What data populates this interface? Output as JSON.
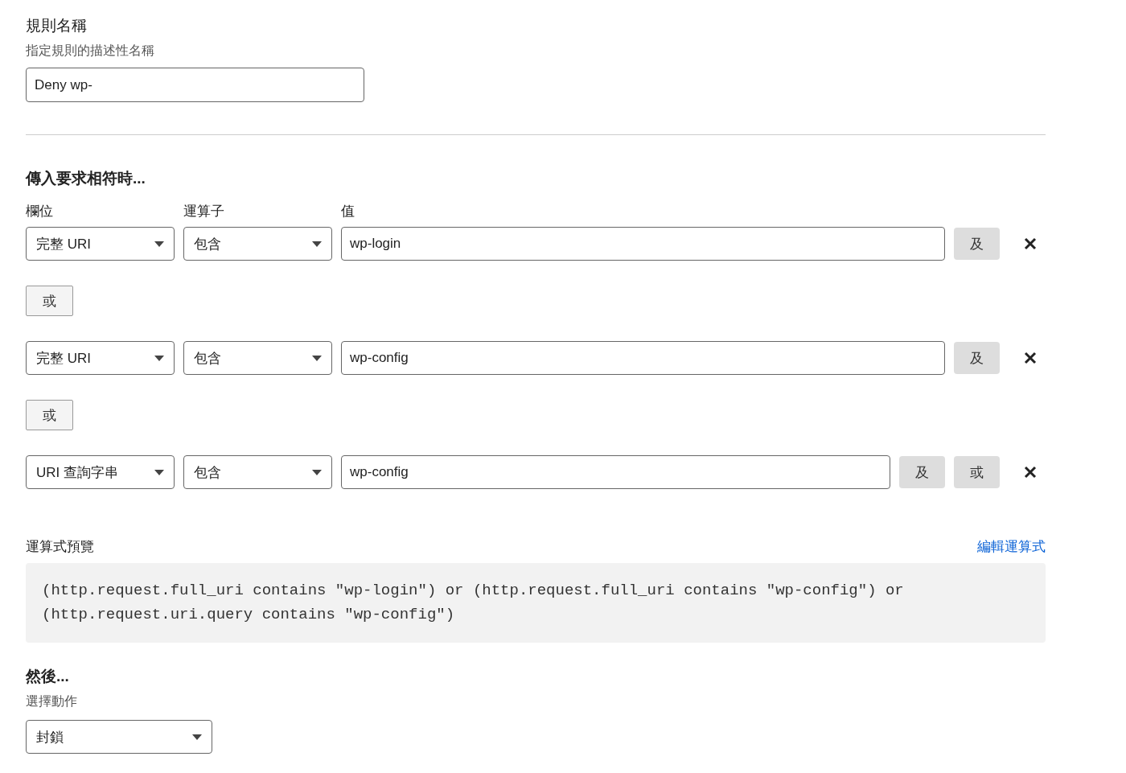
{
  "rule_name": {
    "label": "規則名稱",
    "hint": "指定規則的描述性名稱",
    "value": "Deny wp-"
  },
  "match": {
    "heading": "傳入要求相符時...",
    "columns": [
      "欄位",
      "運算子",
      "值"
    ],
    "rows": [
      {
        "kind": "condition",
        "field": "完整 URI",
        "operator": "包含",
        "value": "wp-login",
        "buttons": [
          "及"
        ]
      },
      {
        "kind": "or",
        "label": "或"
      },
      {
        "kind": "condition",
        "field": "完整 URI",
        "operator": "包含",
        "value": "wp-config",
        "buttons": [
          "及"
        ]
      },
      {
        "kind": "or",
        "label": "或"
      },
      {
        "kind": "condition",
        "field": "URI 查詢字串",
        "operator": "包含",
        "value": "wp-config",
        "buttons": [
          "及",
          "或"
        ]
      }
    ]
  },
  "preview": {
    "label": "運算式預覽",
    "edit_link": "編輯運算式",
    "expression": "(http.request.full_uri contains \"wp-login\") or (http.request.full_uri contains \"wp-config\") or (http.request.uri.query contains \"wp-config\")"
  },
  "then": {
    "heading": "然後...",
    "label": "選擇動作",
    "action": "封鎖"
  }
}
